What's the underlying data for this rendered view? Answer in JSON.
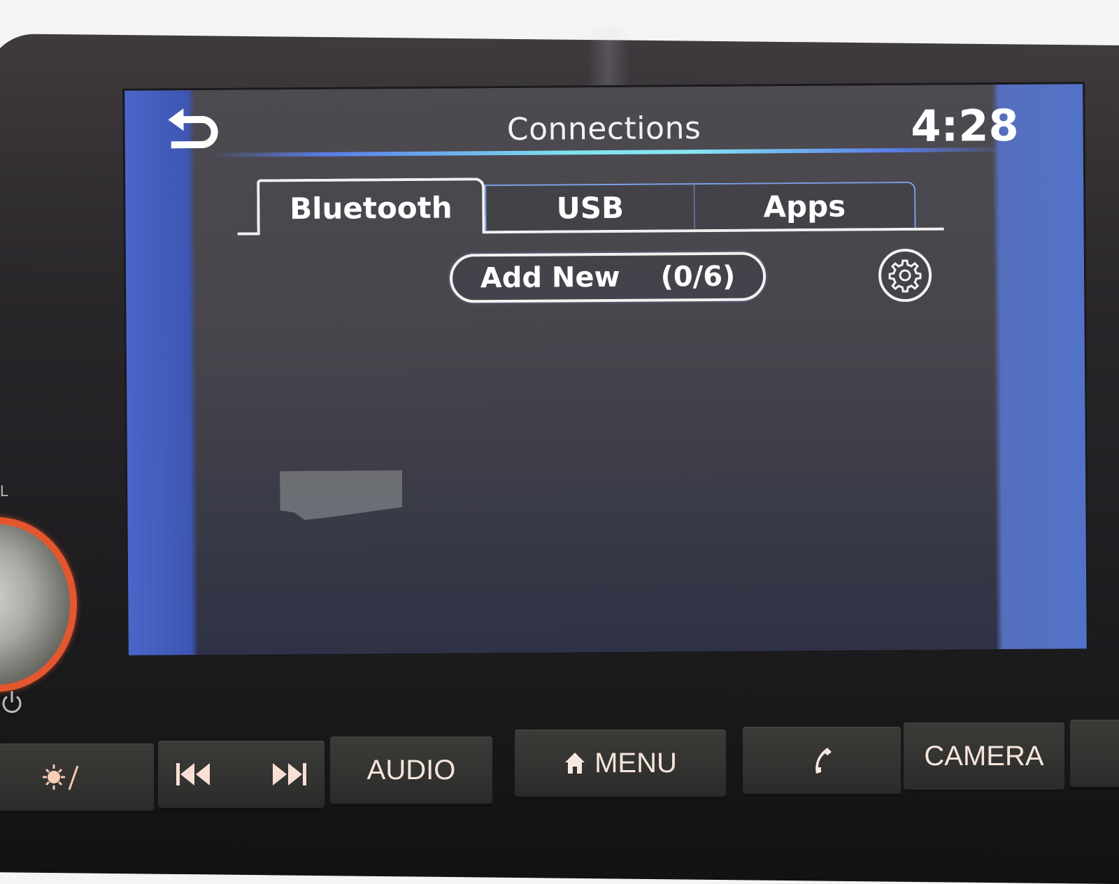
{
  "header": {
    "title": "Connections",
    "clock": "4:28",
    "back_icon": "back-arrow-icon"
  },
  "tabs": [
    {
      "label": "Bluetooth",
      "active": true
    },
    {
      "label": "USB",
      "active": false
    },
    {
      "label": "Apps",
      "active": false
    }
  ],
  "bluetooth": {
    "add_new_label": "Add New",
    "device_count": "(0/6)",
    "settings_icon": "gear-icon"
  },
  "colors": {
    "accent_line": "#7fe2f0",
    "tab_border_inactive": "#7aa0e6",
    "knob_ring": "#e4572e",
    "hw_label": "#f6e6dc"
  },
  "hardware": {
    "volume_label": "L",
    "buttons": [
      {
        "id": "day-night",
        "icon": "sun-moon-icon",
        "label": ""
      },
      {
        "id": "seek",
        "icons": [
          "skip-back-icon",
          "skip-forward-icon"
        ],
        "label": ""
      },
      {
        "id": "audio",
        "label": "AUDIO"
      },
      {
        "id": "menu",
        "icon": "home-icon",
        "label": "MENU"
      },
      {
        "id": "phone",
        "icon": "phone-icon",
        "label": ""
      },
      {
        "id": "camera",
        "label": "CAMERA"
      }
    ]
  }
}
